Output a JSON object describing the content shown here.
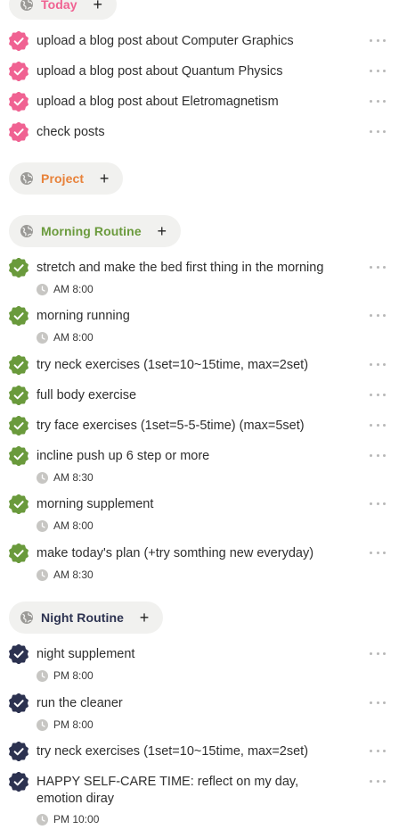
{
  "colors": {
    "today_accent": "#f06292",
    "project_accent": "#e8823a",
    "morning_accent": "#6a9a3c",
    "night_accent": "#2c3250",
    "pill_bg": "#f1f1ef"
  },
  "sections": {
    "today": {
      "title": "Today",
      "tasks": [
        {
          "text": "upload a blog post about Computer Graphics"
        },
        {
          "text": "upload a blog post about Quantum Physics"
        },
        {
          "text": "upload a blog post about Eletromagnetism"
        },
        {
          "text": "check posts"
        }
      ]
    },
    "project": {
      "title": "Project",
      "tasks": []
    },
    "morning": {
      "title": "Morning Routine",
      "tasks": [
        {
          "text": "stretch and make the bed first thing in the morning",
          "time": "AM 8:00"
        },
        {
          "text": "morning running",
          "time": "AM 8:00"
        },
        {
          "text": "try neck exercises (1set=10~15time, max=2set)"
        },
        {
          "text": "full body exercise"
        },
        {
          "text": "try face exercises (1set=5-5-5time) (max=5set)"
        },
        {
          "text": "incline push up 6 step or more",
          "time": "AM 8:30"
        },
        {
          "text": "morning supplement",
          "time": "AM 8:00"
        },
        {
          "text": "make today's plan (+try somthing new everyday)",
          "time": "AM 8:30"
        }
      ]
    },
    "night": {
      "title": "Night Routine",
      "tasks": [
        {
          "text": "night supplement",
          "time": "PM 8:00"
        },
        {
          "text": "run the cleaner",
          "time": "PM 8:00"
        },
        {
          "text": "try neck exercises (1set=10~15time, max=2set)"
        },
        {
          "text": "HAPPY SELF-CARE TIME: reflect on my day, emotion diray",
          "time": "PM 10:00"
        }
      ]
    }
  },
  "add_label": "+"
}
